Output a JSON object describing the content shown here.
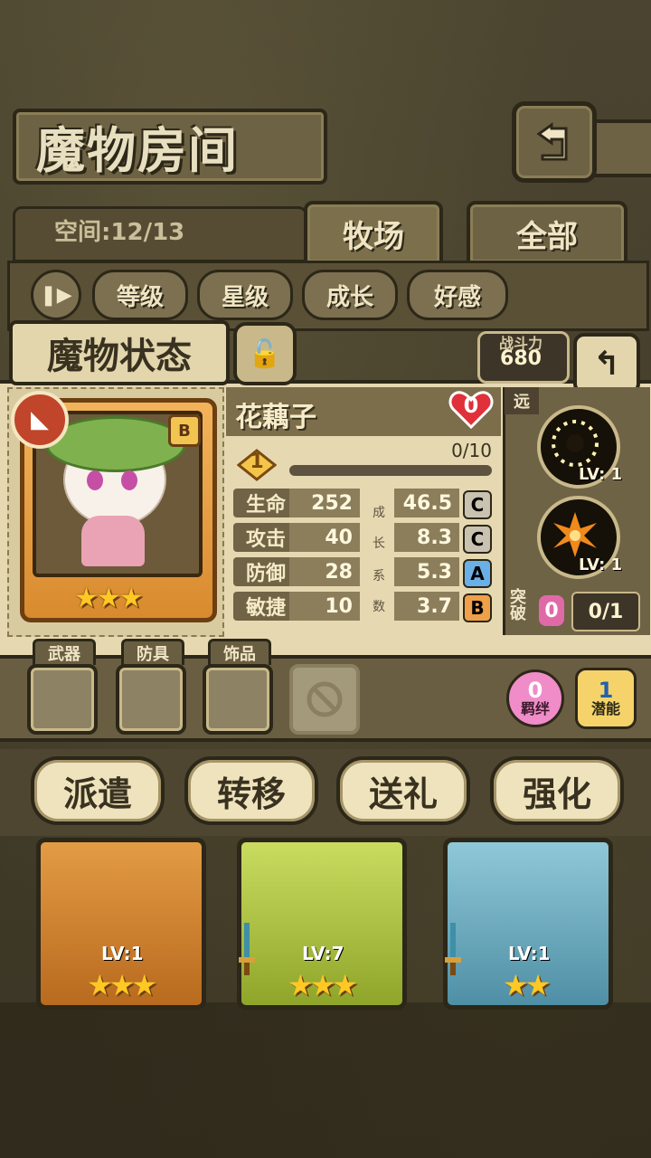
{
  "header": {
    "title": "魔物房间"
  },
  "tabs": {
    "space": "空间:12/13",
    "ranch": "牧场",
    "all": "全部"
  },
  "sort": {
    "level": "等级",
    "star": "星级",
    "growth": "成长",
    "affinity": "好感"
  },
  "status": {
    "label": "魔物状态",
    "power_label": "战斗力",
    "power_value": "680"
  },
  "monster": {
    "name": "花藕子",
    "rank": "B",
    "stars": "★★★",
    "hearts": "0",
    "level": "1",
    "exp": "0/10",
    "exp_fraction": 0.0,
    "growth_label": [
      "成",
      "长",
      "系",
      "数"
    ],
    "stats": [
      {
        "name": "生命",
        "value": "252",
        "growth": "46.5",
        "grade": "C"
      },
      {
        "name": "攻击",
        "value": "40",
        "growth": "8.3",
        "grade": "C"
      },
      {
        "name": "防御",
        "value": "28",
        "growth": "5.3",
        "grade": "A"
      },
      {
        "name": "敏捷",
        "value": "10",
        "growth": "3.7",
        "grade": "B"
      }
    ]
  },
  "skills": {
    "range": "远",
    "items": [
      {
        "lv": "LV: 1"
      },
      {
        "lv": "LV: 1"
      }
    ],
    "break_label": "突破",
    "break_count": "0",
    "break_progress": "0/1"
  },
  "equipment": {
    "weapon": "武器",
    "armor": "防具",
    "accessory": "饰品"
  },
  "badges": {
    "bond_count": "0",
    "bond_label": "羁绊",
    "potential_count": "1",
    "potential_label": "潜能"
  },
  "actions": {
    "dispatch": "派遣",
    "transfer": "转移",
    "gift": "送礼",
    "enhance": "强化"
  },
  "cards": [
    {
      "lv": "LV:1",
      "stars": "★★★"
    },
    {
      "lv": "LV:7",
      "stars": "★★★"
    },
    {
      "lv": "LV:1",
      "stars": "★★"
    }
  ],
  "colors": {
    "grade_C": "#c9c2b0",
    "grade_A": "#6ab0e6",
    "grade_B": "#f0a048",
    "heart": "#e0303a"
  }
}
